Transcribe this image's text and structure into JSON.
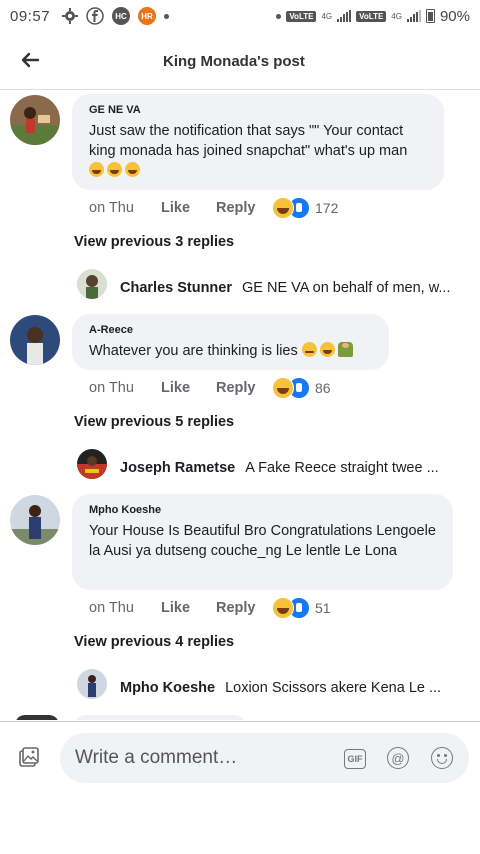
{
  "status_bar": {
    "time": "09:57",
    "notif_icons": [
      "gear-icon",
      "facebook-icon",
      "hc-icon",
      "hr-icon"
    ],
    "hc_label": "HC",
    "hr_label": "HR",
    "volte1": "VoLTE",
    "net1": "4G",
    "volte2": "VoLTE",
    "net2": "4G",
    "battery": "90%"
  },
  "header": {
    "title": "King Monada's post"
  },
  "comments": [
    {
      "author": "GE NE VA",
      "text": "Just saw the notification that says \"\" Your contact king monada has joined snapchat\" what's up man",
      "emojis": [
        "rolling-on-floor-laughing",
        "rolling-on-floor-laughing",
        "rolling-on-floor-laughing"
      ],
      "time": "on Thu",
      "like_label": "Like",
      "reply_label": "Reply",
      "reaction_count": "172",
      "view_previous": "View previous 3 replies",
      "last_reply": {
        "author": "Charles Stunner",
        "text": "GE NE VA on behalf of men, w..."
      }
    },
    {
      "author": "A-Reece",
      "text": "Whatever you are thinking is lies",
      "emojis": [
        "rolling-eyes",
        "rolling-on-floor-laughing",
        "person-gesturing-no"
      ],
      "time": "on Thu",
      "like_label": "Like",
      "reply_label": "Reply",
      "reaction_count": "86",
      "view_previous": "View previous 5 replies",
      "last_reply": {
        "author": "Joseph Rametse",
        "text": "A  Fake  Reece straight twee ..."
      }
    },
    {
      "author": "Mpho Koeshe",
      "text": "Your House Is Beautiful Bro Congratulations Lengoele la Ausi ya dutseng couche_ng Le lentle Le Lona",
      "time": "on Thu",
      "like_label": "Like",
      "reply_label": "Reply",
      "reaction_count": "51",
      "view_previous": "View previous 4 replies",
      "last_reply": {
        "author": "Mpho Koeshe",
        "text": "Loxion Scissors akere Kena Le ..."
      }
    }
  ],
  "composer": {
    "placeholder": "Write a comment…",
    "gif_label": "GIF",
    "at_label": "@"
  },
  "colors": {
    "bubble": "#f0f2f5",
    "like_blue": "#1877f2",
    "haha_yellow": "#f7c23b",
    "muted_text": "#65676b"
  }
}
